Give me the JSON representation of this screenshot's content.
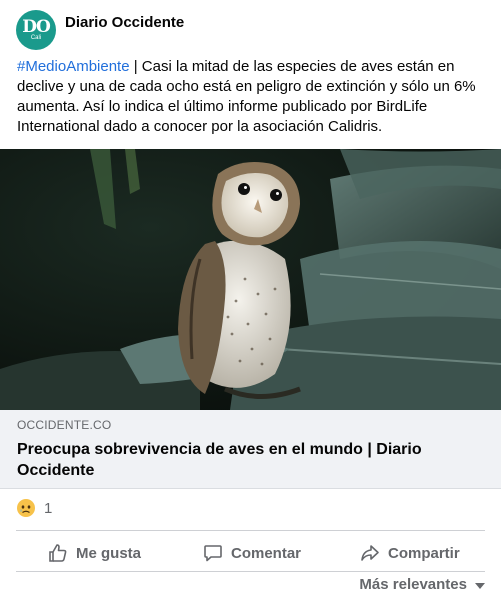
{
  "page": {
    "name": "Diario Occidente",
    "avatar_monogram": "DO",
    "avatar_sub": "Cali"
  },
  "post": {
    "hashtag": "#MedioAmbiente",
    "text": " | Casi la mitad de las especies de aves están en declive y una de cada ocho está en peligro de extinción y sólo un 6% aumenta. Así lo indica el último informe publicado por BirdLife International dado a conocer por la asociación Calidris."
  },
  "link_preview": {
    "domain": "OCCIDENTE.CO",
    "title": "Preocupa sobrevivencia de aves en el mundo | Diario Occidente"
  },
  "reactions": {
    "icon": "sad-reaction-icon",
    "count": "1"
  },
  "actions": {
    "like_label": "Me gusta",
    "comment_label": "Comentar",
    "share_label": "Compartir"
  },
  "comments_sort": {
    "label": "Más relevantes"
  },
  "colors": {
    "hashtag": "#216fdb",
    "secondary_text": "#65676b",
    "link_bg": "#f0f2f5",
    "avatar_bg": "#1a9a8c"
  }
}
